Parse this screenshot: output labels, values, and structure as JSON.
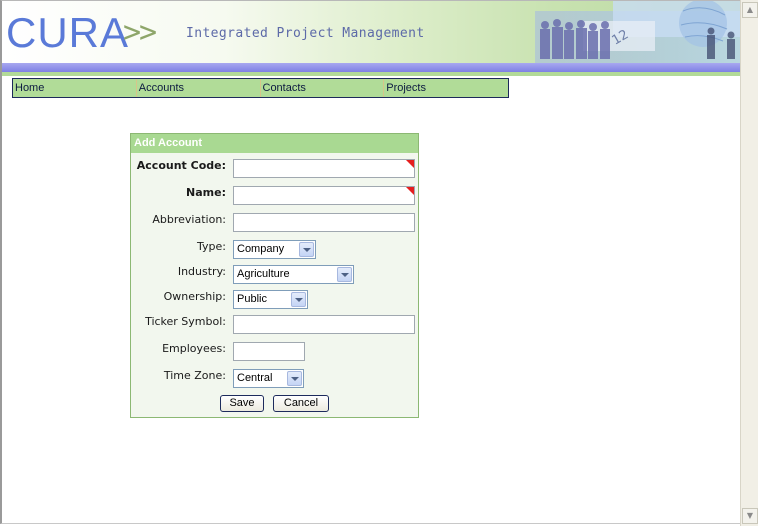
{
  "banner": {
    "logo_text": "CURA",
    "logo_arrows": ">>",
    "tagline": "Integrated Project Management"
  },
  "nav": {
    "items": [
      {
        "label": "Home"
      },
      {
        "label": "Accounts"
      },
      {
        "label": "Contacts"
      },
      {
        "label": "Projects"
      }
    ]
  },
  "form": {
    "title": "Add Account",
    "fields": {
      "account_code": {
        "label": "Account Code:",
        "value": "",
        "required": true
      },
      "name": {
        "label": "Name:",
        "value": "",
        "required": true
      },
      "abbreviation": {
        "label": "Abbreviation:",
        "value": ""
      },
      "type": {
        "label": "Type:",
        "selected": "Company"
      },
      "industry": {
        "label": "Industry:",
        "selected": "Agriculture"
      },
      "ownership": {
        "label": "Ownership:",
        "selected": "Public"
      },
      "ticker_symbol": {
        "label": "Ticker Symbol:",
        "value": ""
      },
      "employees": {
        "label": "Employees:",
        "value": ""
      },
      "time_zone": {
        "label": "Time Zone:",
        "selected": "Central"
      }
    },
    "buttons": {
      "save": "Save",
      "cancel": "Cancel"
    }
  },
  "colors": {
    "nav_bg": "#b1dc98",
    "panel_header": "#a9d992",
    "required_marker": "#e51e1e",
    "logo": "#5a7ad8"
  }
}
